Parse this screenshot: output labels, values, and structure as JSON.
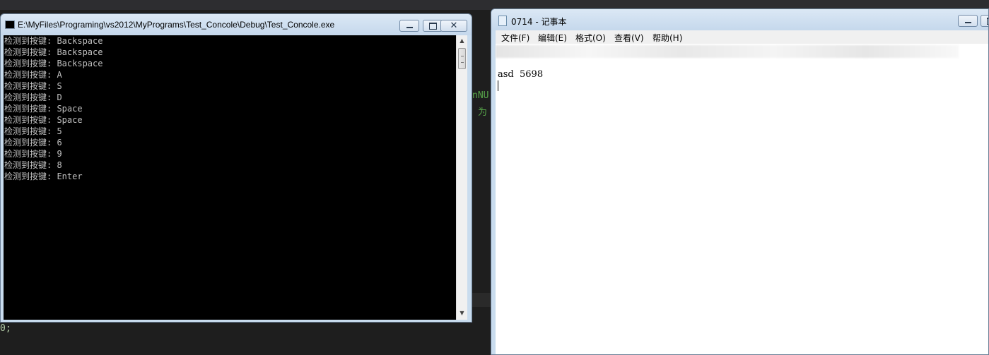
{
  "background": {
    "code_green_1": "nNU",
    "code_green_2": "为",
    "code_yellow": "0;"
  },
  "console": {
    "title": "E:\\MyFiles\\Programing\\vs2012\\MyPrograms\\Test_Concole\\Debug\\Test_Concole.exe",
    "lines": [
      "检测到按键: Backspace",
      "检测到按键: Backspace",
      "检测到按键: Backspace",
      "检测到按键: A",
      "检测到按键: S",
      "检测到按键: D",
      "检测到按键: Space",
      "检测到按键: Space",
      "检测到按键: 5",
      "检测到按键: 6",
      "检测到按键: 9",
      "检测到按键: 8",
      "检测到按键: Enter"
    ]
  },
  "notepad": {
    "title": "0714 - 记事本",
    "menu": [
      "文件(F)",
      "编辑(E)",
      "格式(O)",
      "查看(V)",
      "帮助(H)"
    ],
    "content": "asd  5698"
  },
  "colors": {
    "console_bg": "#000000",
    "console_text": "#c0c0c0",
    "titlebar": "#c9dcee"
  }
}
